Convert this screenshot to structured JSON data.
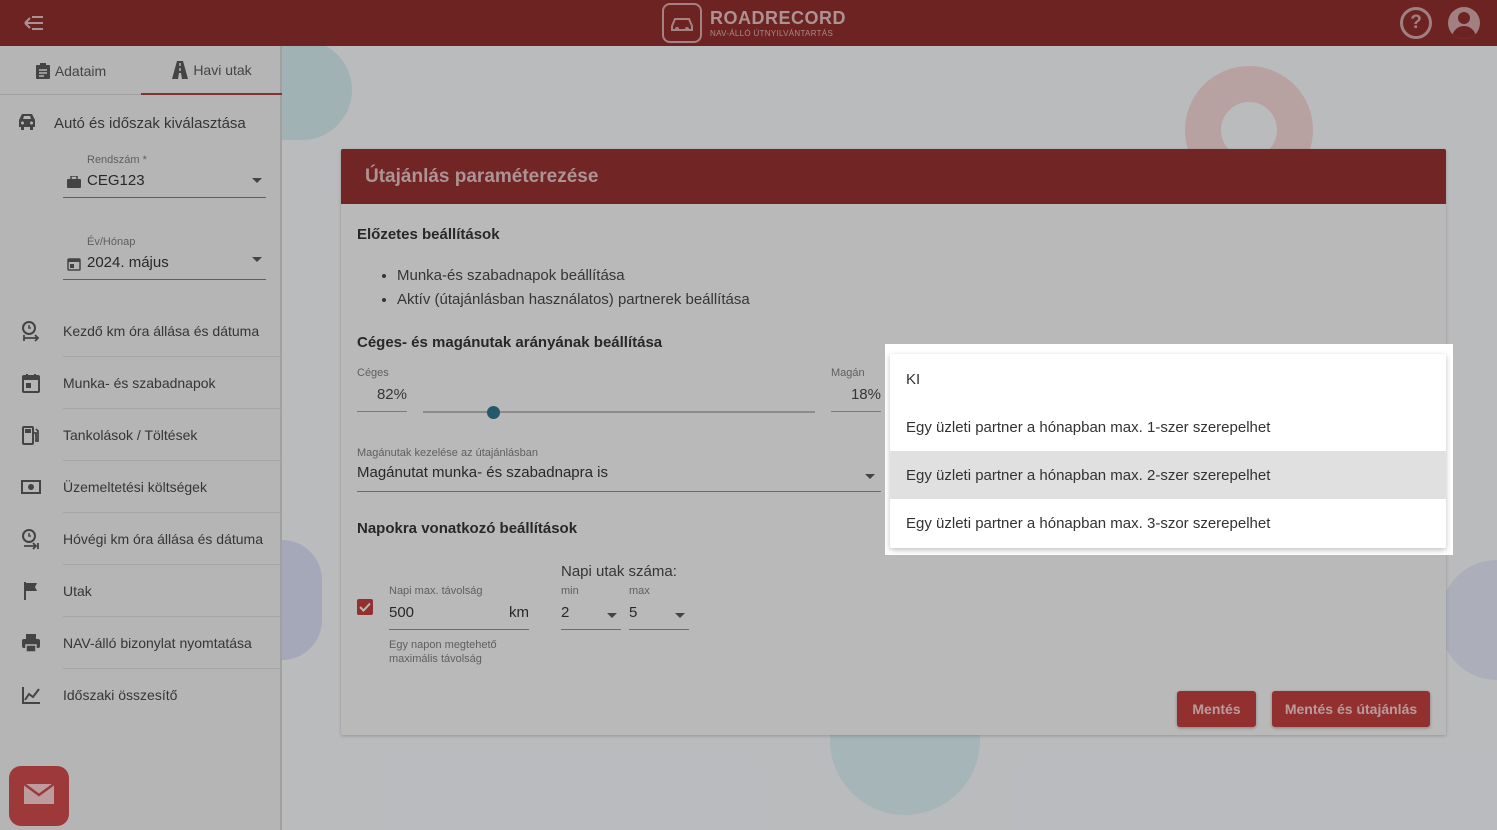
{
  "app": {
    "logo_title": "ROADRECORD",
    "logo_subtitle": "NAV-ÁLLÓ ÚTNYILVÁNTARTÁS"
  },
  "colors": {
    "header_bg": "#8a2c2c",
    "accent": "#b73d3d",
    "slider": "#2f6f85"
  },
  "sidebar": {
    "tabs": [
      {
        "label": "Adataim",
        "icon": "clipboard-icon"
      },
      {
        "label": "Havi utak",
        "icon": "road-icon"
      }
    ],
    "section_title": "Autó és időszak kiválasztása",
    "plate_field": {
      "label": "Rendszám *",
      "value": "CEG123"
    },
    "month_field": {
      "label": "Év/Hónap",
      "value": "2024. május"
    },
    "items": [
      {
        "label": "Kezdő km óra állása és dátuma",
        "icon": "clock-start-icon"
      },
      {
        "label": "Munka- és szabadnapok",
        "icon": "calendar-icon"
      },
      {
        "label": "Tankolások / Töltések",
        "icon": "fuel-icon"
      },
      {
        "label": "Üzemeltetési költségek",
        "icon": "money-icon"
      },
      {
        "label": "Hóvégi km óra állása és dátuma",
        "icon": "clock-end-icon"
      },
      {
        "label": "Utak",
        "icon": "flag-icon"
      },
      {
        "label": "NAV-álló bizonylat nyomtatása",
        "icon": "printer-icon"
      },
      {
        "label": "Időszaki összesítő",
        "icon": "chart-line-icon"
      }
    ]
  },
  "card": {
    "title": "Útajánlás paraméterezése",
    "prior_settings_title": "Előzetes beállítások",
    "bullets": [
      "Munka-és szabadnapok beállítása",
      "Aktív (útajánlásban használatos) partnerek beállítása"
    ],
    "ratio_title": "Céges- és magánutak arányának beállítása",
    "company_label": "Céges",
    "company_value": "82%",
    "private_label": "Magán",
    "private_value": "18%",
    "slider_fraction": 0.18,
    "private_handling_label": "Magánutak kezelése az útajánlásban",
    "private_handling_value": "Magánutat munka- és szabadnapra is",
    "days_title": "Napokra vonatkozó beállítások",
    "max_distance_label": "Napi max. távolság",
    "max_distance_value": "500",
    "max_distance_unit": "km",
    "max_distance_hint": "Egy napon megtehető maximális távolság",
    "trips_title": "Napi utak száma:",
    "min_label": "min",
    "min_value": "2",
    "max_label": "max",
    "max_value": "5",
    "save_button": "Mentés",
    "save_and_plan_button": "Mentés és útajánlás"
  },
  "dropdown": {
    "options": [
      "KI",
      "Egy üzleti partner a hónapban max. 1-szer szerepelhet",
      "Egy üzleti partner a hónapban max. 2-szer szerepelhet",
      "Egy üzleti partner a hónapban max. 3-szor szerepelhet"
    ],
    "selected_index": 2
  }
}
